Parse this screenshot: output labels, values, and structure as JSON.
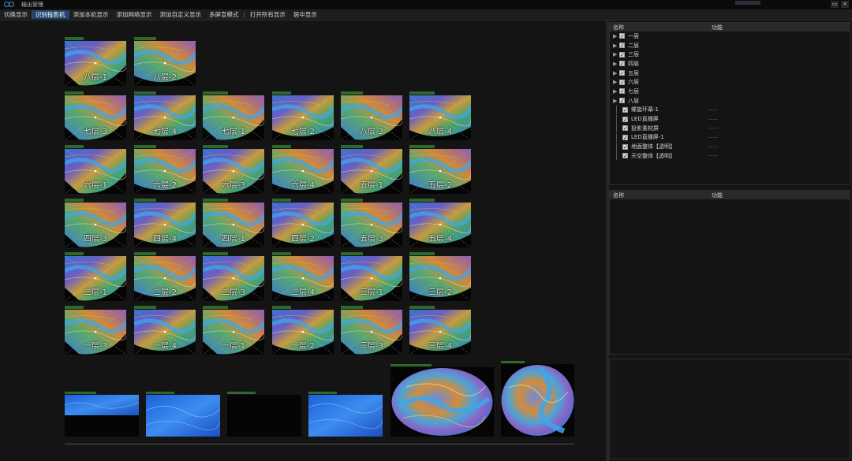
{
  "app": {
    "title": "输出管理"
  },
  "window_controls": {
    "restore": "▭",
    "close": "×"
  },
  "menu": [
    {
      "label": "切换显示",
      "active": false
    },
    {
      "label": "识别投影机",
      "active": true
    },
    {
      "label": "添加本机显示",
      "active": false
    },
    {
      "label": "添加网络显示",
      "active": false
    },
    {
      "label": "添加自定义显示",
      "active": false
    },
    {
      "label": "多屏宣模式",
      "active": false
    },
    {
      "label": "打开所有显示",
      "active": false
    },
    {
      "label": "居中显示",
      "active": false
    }
  ],
  "tiles": [
    [
      "八层-1",
      "八层-2"
    ],
    [
      "七层-3",
      "七层-4",
      "七层-1",
      "七层-2",
      "八层-3",
      "八层-4"
    ],
    [
      "六层-1",
      "六层-2",
      "六层-3",
      "六层-4",
      "五层-1",
      "五层-2"
    ],
    [
      "四层-3",
      "四层-4",
      "四层-1",
      "四层-2",
      "五层-3",
      "五层-4"
    ],
    [
      "二层-1",
      "二层-2",
      "二层-3",
      "二层-4",
      "三层-1",
      "三层-2"
    ],
    [
      "一层-3",
      "一层-4",
      "一层-1",
      "一层-2",
      "三层-3",
      "三层-4"
    ]
  ],
  "tree_panel": {
    "headers": {
      "name": "名称",
      "function": "功能"
    },
    "layers": [
      "一层",
      "二层",
      "三层",
      "四层",
      "五层",
      "六层",
      "七层",
      "八层"
    ],
    "extras": [
      {
        "label": "螺旋环幕-1",
        "func": "——"
      },
      {
        "label": "LED直播屏",
        "func": "——"
      },
      {
        "label": "投影素材屏",
        "func": "——"
      },
      {
        "label": "LED直播屏-1",
        "func": "——"
      },
      {
        "label": "地面整体【透明】",
        "func": "——"
      },
      {
        "label": "天空整体【透明】",
        "func": "——"
      }
    ]
  },
  "detail_panel": {
    "headers": {
      "name": "名称",
      "function": "功能"
    }
  },
  "colors": {
    "accent": "#24466e",
    "background": "#141414",
    "panel_header": "#2a2a2a",
    "caption": "#2c6a2c"
  }
}
